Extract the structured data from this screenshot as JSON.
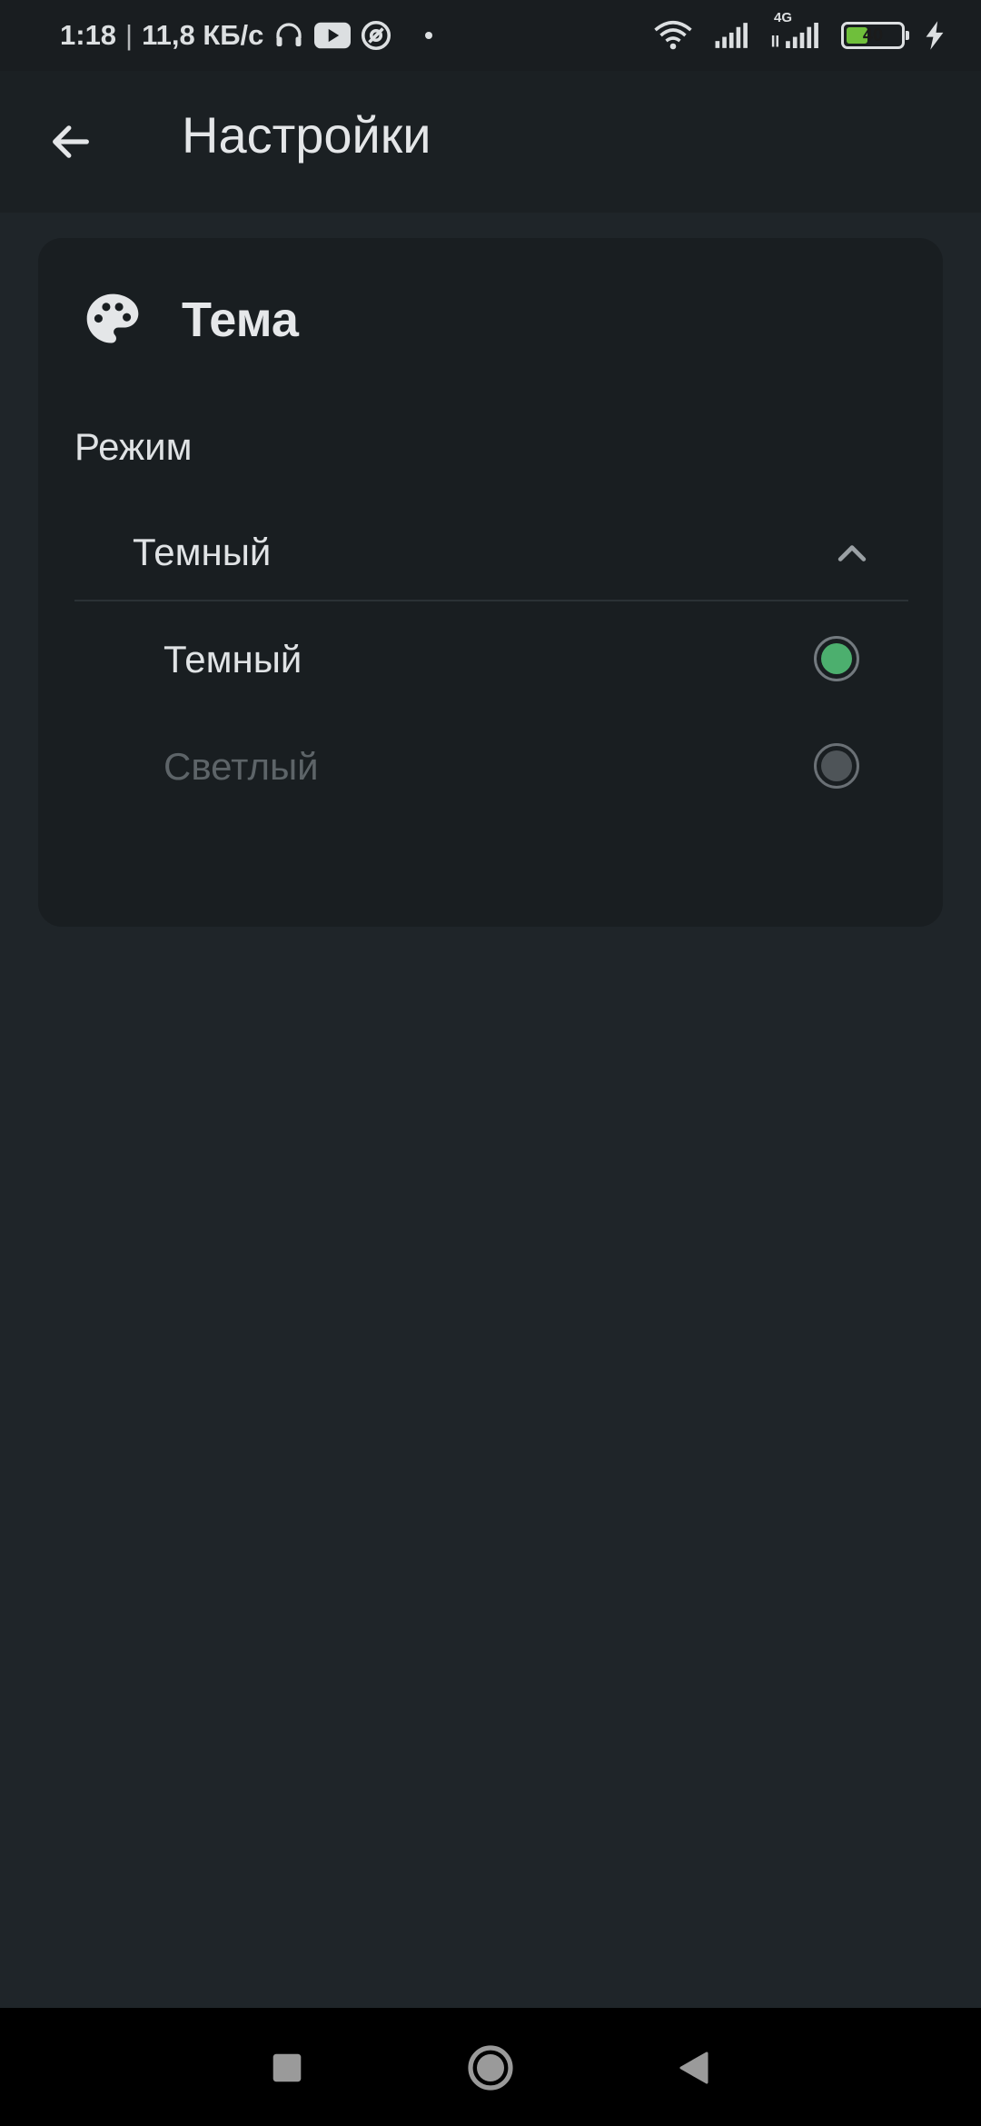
{
  "status_bar": {
    "time": "1:18",
    "separator": "|",
    "speed": "11,8 КБ/с",
    "battery_level": "40",
    "network_label": "4G"
  },
  "app_bar": {
    "title": "Настройки"
  },
  "theme_card": {
    "title": "Тема",
    "mode_label": "Режим",
    "dropdown_value": "Темный",
    "options": [
      {
        "label": "Темный",
        "selected": true
      },
      {
        "label": "Светлый",
        "selected": false
      }
    ]
  },
  "colors": {
    "accent": "#4caf6e",
    "background": "#1f2529",
    "card": "#191e21"
  }
}
